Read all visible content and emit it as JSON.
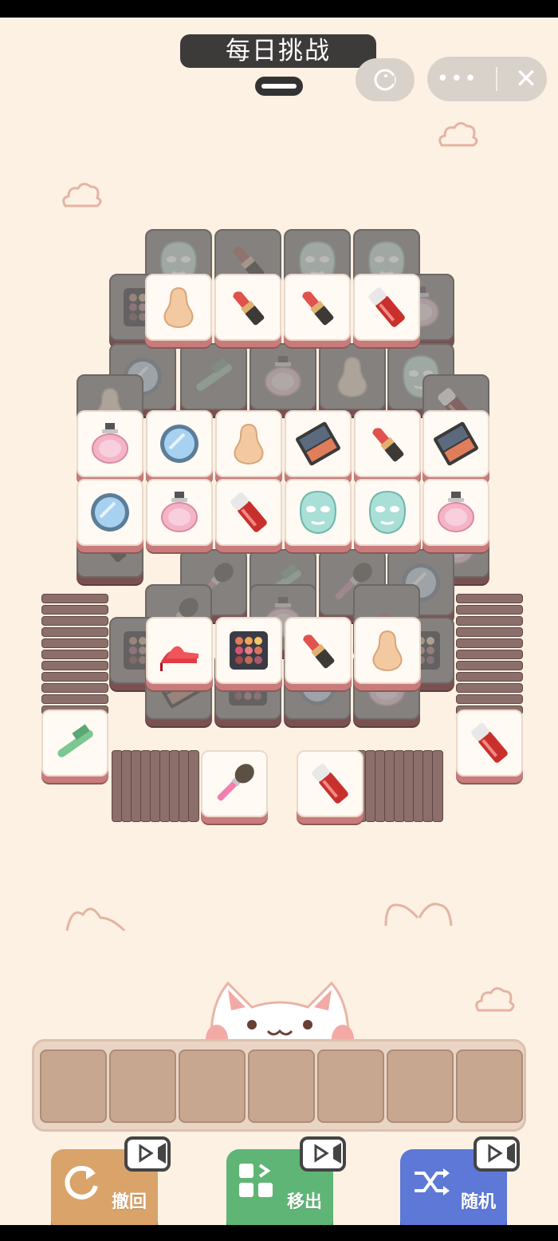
{
  "header": {
    "title": "每日挑战"
  },
  "game_board": {
    "top_layer": [
      {
        "item": "sponge-icon"
      },
      {
        "item": "lipstick-icon"
      },
      {
        "item": "lipstick-icon"
      },
      {
        "item": "lip-gloss-icon"
      },
      {
        "item": "perfume-icon"
      },
      {
        "item": "mirror-icon"
      },
      {
        "item": "sponge-icon"
      },
      {
        "item": "eyeshadow-palette-icon"
      },
      {
        "item": "lipstick-icon"
      },
      {
        "item": "eyeshadow-palette-icon"
      },
      {
        "item": "mirror-icon"
      },
      {
        "item": "perfume-icon"
      },
      {
        "item": "lip-gloss-icon"
      },
      {
        "item": "face-mask-icon"
      },
      {
        "item": "face-mask-icon"
      },
      {
        "item": "perfume-icon"
      },
      {
        "item": "high-heel-icon"
      },
      {
        "item": "eyeshadow-palette-icon"
      },
      {
        "item": "lipstick-icon"
      },
      {
        "item": "sponge-icon"
      },
      {
        "item": "comb-icon"
      },
      {
        "item": "lip-gloss-icon"
      },
      {
        "item": "makeup-brush-icon"
      },
      {
        "item": "lip-gloss-icon"
      }
    ]
  },
  "tray": {
    "slot_count": 7
  },
  "powerups": {
    "undo_label": "撤回",
    "move_out_label": "移出",
    "shuffle_label": "随机"
  },
  "colors": {
    "background": "#fcf1e3",
    "undo": "#d9a36a",
    "move_out": "#5fb575",
    "shuffle": "#5d78d6"
  }
}
